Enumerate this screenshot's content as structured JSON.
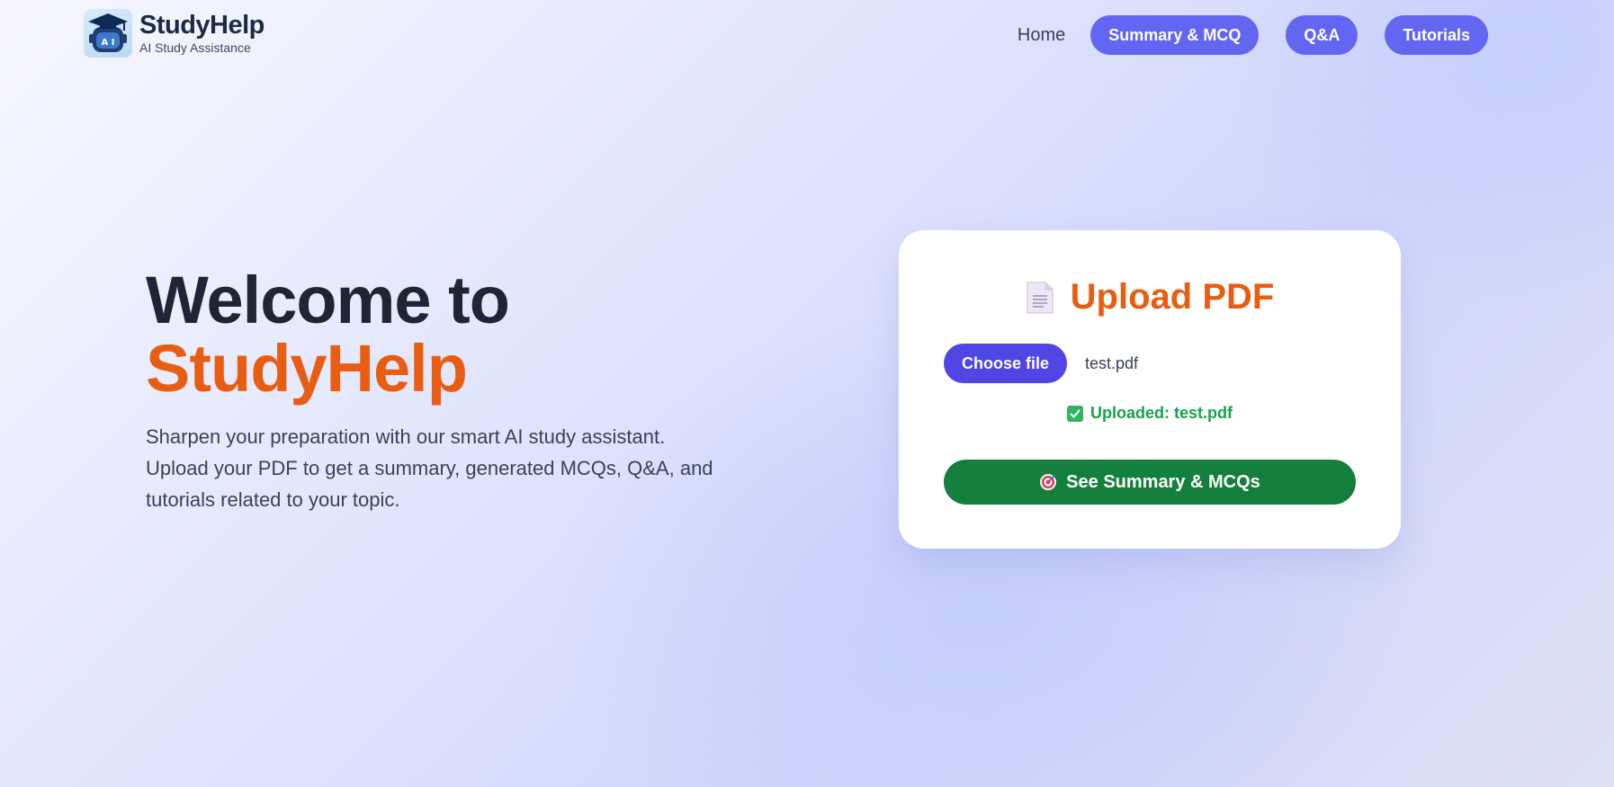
{
  "brand": {
    "name": "StudyHelp",
    "tagline": "AI Study Assistance",
    "badge_text": "A I"
  },
  "nav": {
    "home": "Home",
    "items": [
      "Summary & MCQ",
      "Q&A",
      "Tutorials"
    ]
  },
  "hero": {
    "title_line1": "Welcome to",
    "title_line2": "StudyHelp",
    "description": "Sharpen your preparation with our smart AI study assistant. Upload your PDF to get a summary, generated MCQs, Q&A, and tutorials related to your topic."
  },
  "upload": {
    "icon": "document-icon",
    "title": "Upload PDF",
    "choose_label": "Choose file",
    "file_name": "test.pdf",
    "status_icon": "check-icon",
    "status": "Uploaded: test.pdf",
    "action_icon": "target-icon",
    "action_label": "See Summary & MCQs"
  },
  "colors": {
    "accent": "#6366f1",
    "brand_orange": "#e85d12",
    "choose_button": "#4f46e5",
    "success": "#16a34a",
    "action_button": "#15803d"
  }
}
